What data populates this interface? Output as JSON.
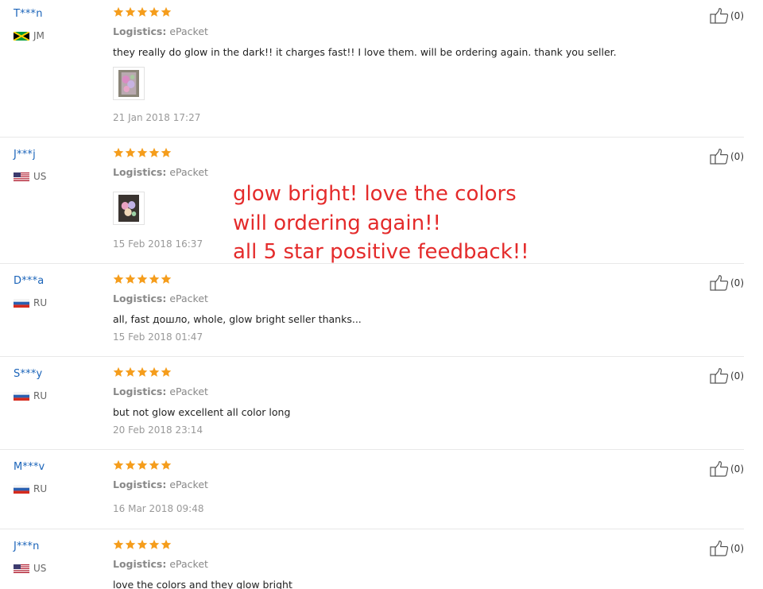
{
  "reviews": [
    {
      "user": "T***n",
      "country": "JM",
      "flag": "jm",
      "stars": 5,
      "logistics_label": "Logistics:",
      "logistics": "ePacket",
      "comment": "they really do glow in the dark!! it charges fast!! I love them. will be ordering again. thank you seller.",
      "has_photo": true,
      "date": "21 Jan 2018 17:27",
      "useful": "(0)"
    },
    {
      "user": "J***j",
      "country": "US",
      "flag": "us",
      "stars": 5,
      "logistics_label": "Logistics:",
      "logistics": "ePacket",
      "comment": "",
      "has_photo": true,
      "date": "15 Feb 2018 16:37",
      "useful": "(0)"
    },
    {
      "user": "D***a",
      "country": "RU",
      "flag": "ru",
      "stars": 5,
      "logistics_label": "Logistics:",
      "logistics": "ePacket",
      "comment": "all, fast дошло, whole, glow bright seller thanks...",
      "has_photo": false,
      "date": "15 Feb 2018 01:47",
      "useful": "(0)"
    },
    {
      "user": "S***y",
      "country": "RU",
      "flag": "ru",
      "stars": 5,
      "logistics_label": "Logistics:",
      "logistics": "ePacket",
      "comment": "but not glow excellent all color long",
      "has_photo": false,
      "date": "20 Feb 2018 23:14",
      "useful": "(0)"
    },
    {
      "user": "M***v",
      "country": "RU",
      "flag": "ru",
      "stars": 5,
      "logistics_label": "Logistics:",
      "logistics": "ePacket",
      "comment": "",
      "has_photo": false,
      "date": "16 Mar 2018 09:48",
      "useful": "(0)"
    },
    {
      "user": "J***n",
      "country": "US",
      "flag": "us",
      "stars": 5,
      "logistics_label": "Logistics:",
      "logistics": "ePacket",
      "comment": "love the colors and they glow bright",
      "has_photo": false,
      "date": "",
      "useful": "(0)"
    }
  ],
  "overlay": {
    "line1": "glow bright! love the colors",
    "line2": "will ordering again!!",
    "line3": "all 5 star positive feedback!!"
  },
  "colors": {
    "username": "#1b64b9",
    "star": "#f59d1c",
    "overlay": "#e42b2b",
    "divider": "#e8e8e8"
  },
  "icons": {
    "rating": "star-icon",
    "useful": "thumbs-up-icon"
  }
}
